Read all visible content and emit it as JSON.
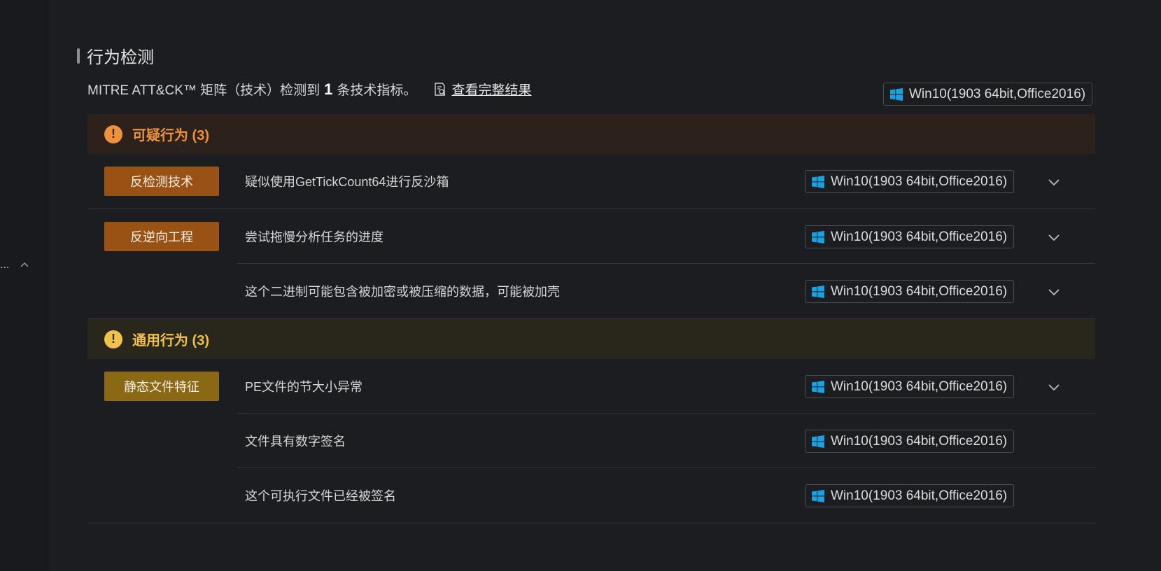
{
  "side": {
    "ellipsis": "..."
  },
  "section": {
    "title": "行为检测"
  },
  "summary": {
    "prefix": "MITRE ATT&CK™ 矩阵（技术）检测到",
    "count": "1",
    "suffix": "条技术指标。",
    "view_link": "查看完整结果"
  },
  "env_label": "Win10(1903 64bit,Office2016)",
  "groups": [
    {
      "title": "可疑行为 (3)",
      "icon": "exclamation-icon",
      "color": "#f0913b",
      "rows": [
        {
          "tag": "反检测技术",
          "desc": "疑似使用GetTickCount64进行反沙箱",
          "env": "Win10(1903 64bit,Office2016)",
          "expandable": true
        },
        {
          "tag": "反逆向工程",
          "desc": "尝试拖慢分析任务的进度",
          "env": "Win10(1903 64bit,Office2016)",
          "expandable": true
        },
        {
          "tag": "",
          "desc": "这个二进制可能包含被加密或被压缩的数据，可能被加壳",
          "env": "Win10(1903 64bit,Office2016)",
          "expandable": true
        }
      ]
    },
    {
      "title": "通用行为 (3)",
      "icon": "exclamation-icon",
      "color": "#f2c14a",
      "rows": [
        {
          "tag": "静态文件特征",
          "desc": "PE文件的节大小异常",
          "env": "Win10(1903 64bit,Office2016)",
          "expandable": true
        },
        {
          "tag": "",
          "desc": "文件具有数字签名",
          "env": "Win10(1903 64bit,Office2016)",
          "expandable": false
        },
        {
          "tag": "",
          "desc": "这个可执行文件已经被签名",
          "env": "Win10(1903 64bit,Office2016)",
          "expandable": false
        }
      ]
    }
  ]
}
